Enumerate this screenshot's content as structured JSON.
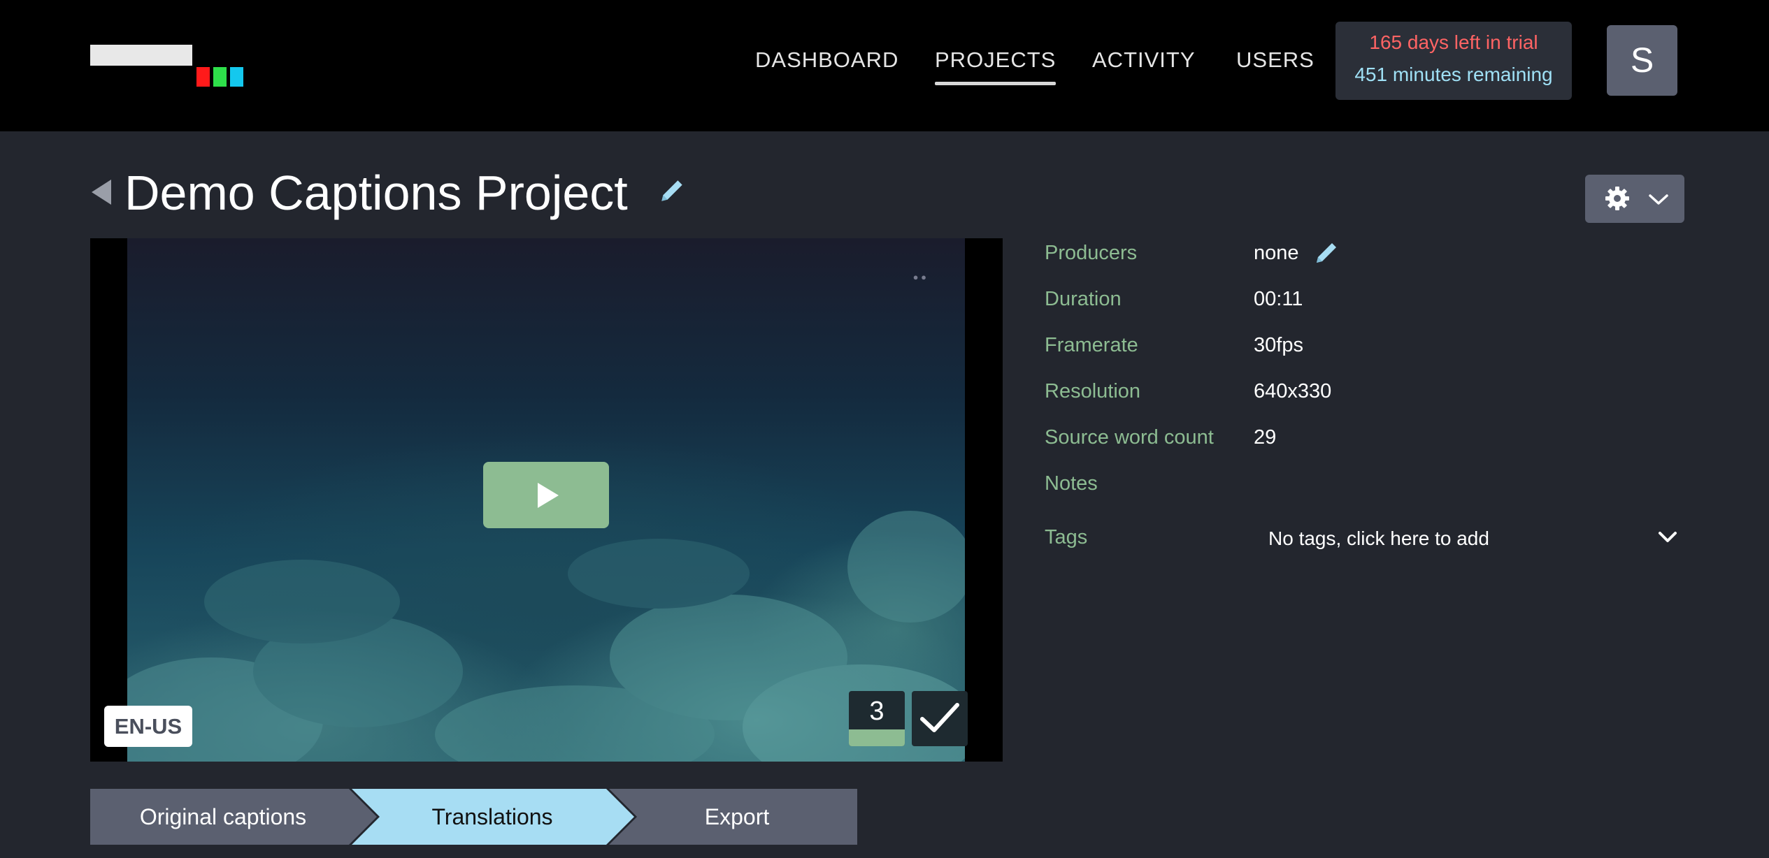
{
  "nav": {
    "items": [
      {
        "label": "DASHBOARD",
        "active": false
      },
      {
        "label": "PROJECTS",
        "active": true
      },
      {
        "label": "ACTIVITY",
        "active": false
      },
      {
        "label": "USERS",
        "active": false
      }
    ]
  },
  "trial": {
    "days_text": "165 days left in trial",
    "minutes_text": "451 minutes remaining"
  },
  "user": {
    "initial": "S"
  },
  "project": {
    "title": "Demo Captions Project"
  },
  "video": {
    "language_badge": "EN-US",
    "caption_count": "3"
  },
  "metadata": {
    "producers": {
      "label": "Producers",
      "value": "none"
    },
    "duration": {
      "label": "Duration",
      "value": "00:11"
    },
    "framerate": {
      "label": "Framerate",
      "value": "30fps"
    },
    "resolution": {
      "label": "Resolution",
      "value": "640x330"
    },
    "word_count": {
      "label": "Source word count",
      "value": "29"
    },
    "notes": {
      "label": "Notes",
      "value": ""
    },
    "tags": {
      "label": "Tags",
      "placeholder": "No tags, click here to add"
    }
  },
  "workflow": {
    "steps": [
      {
        "label": "Original captions",
        "active": false
      },
      {
        "label": "Translations",
        "active": true
      },
      {
        "label": "Export",
        "active": false
      }
    ]
  },
  "colors": {
    "background": "#23262e",
    "topbar": "#000000",
    "accent_green": "#8dbc92",
    "accent_blue": "#a7ddf3",
    "trial_red": "#ff6464",
    "step_inactive": "#5b6070"
  }
}
